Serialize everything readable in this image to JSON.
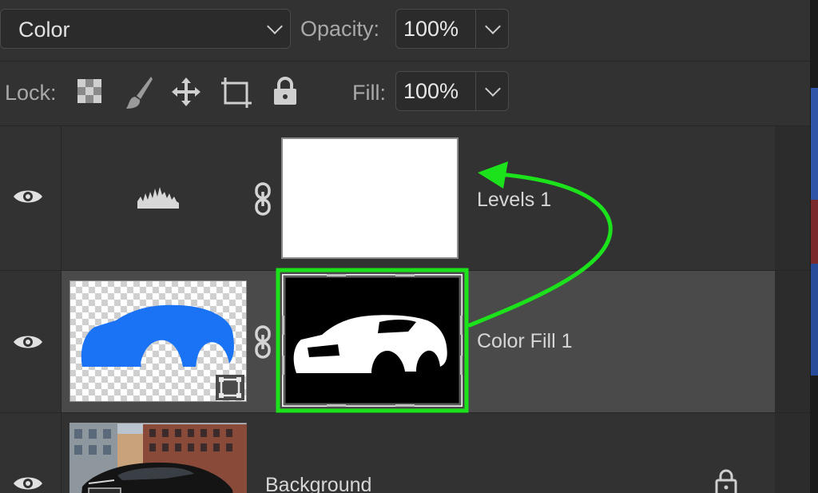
{
  "blend_mode": {
    "value": "Color"
  },
  "opacity": {
    "label": "Opacity:",
    "value": "100%"
  },
  "lock": {
    "label": "Lock:",
    "icons": [
      "lock-transparent-pixels-icon",
      "lock-image-pixels-icon",
      "lock-position-icon",
      "lock-artboard-icon",
      "lock-all-icon"
    ]
  },
  "fill": {
    "label": "Fill:",
    "value": "100%"
  },
  "layers": [
    {
      "name": "Levels 1",
      "type": "adjustment",
      "visible": true,
      "icon": "levels-histogram-icon",
      "mask": "white"
    },
    {
      "name": "Color Fill 1",
      "type": "fill",
      "visible": true,
      "selected": true,
      "fill_color": "#1a73f5",
      "mask": "car-silhouette",
      "mask_highlight": "#1be21b"
    },
    {
      "name": "Background",
      "type": "image",
      "visible": true,
      "locked": true
    }
  ],
  "annotation": {
    "color": "#1be21b",
    "description": "arrow from mask to Levels 1"
  }
}
